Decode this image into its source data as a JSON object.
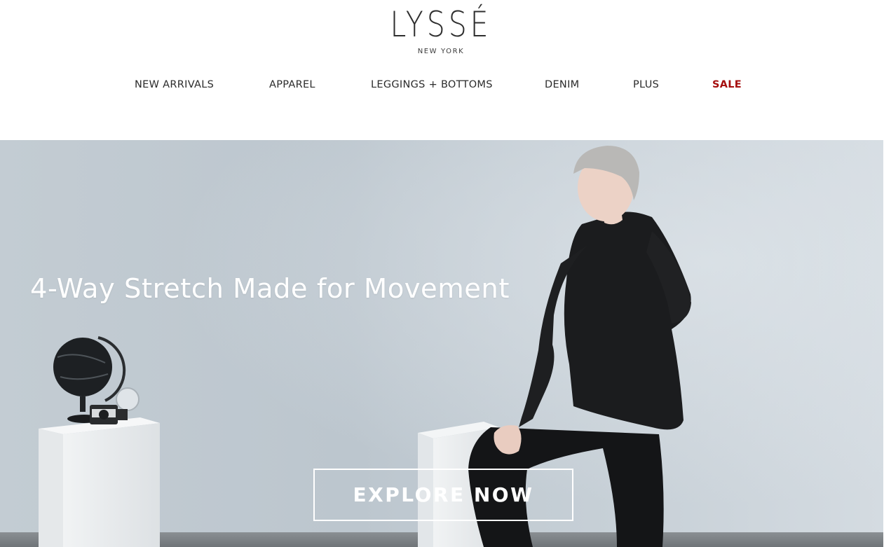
{
  "header": {
    "logo": {
      "brand": "LYSSÉ",
      "location": "NEW YORK"
    },
    "nav": [
      {
        "label": "NEW ARRIVALS"
      },
      {
        "label": "APPAREL"
      },
      {
        "label": "LEGGINGS + BOTTOMS"
      },
      {
        "label": "DENIM"
      },
      {
        "label": "PLUS"
      },
      {
        "label": "SALE",
        "highlight_color": "#a50d0d"
      }
    ]
  },
  "hero": {
    "headline": "4-Way Stretch Made for Movement",
    "cta_label": "EXPLORE NOW",
    "image_subject": "Model in black shirt and black leggings posing beside white pedestals with a globe and vintage camera"
  }
}
